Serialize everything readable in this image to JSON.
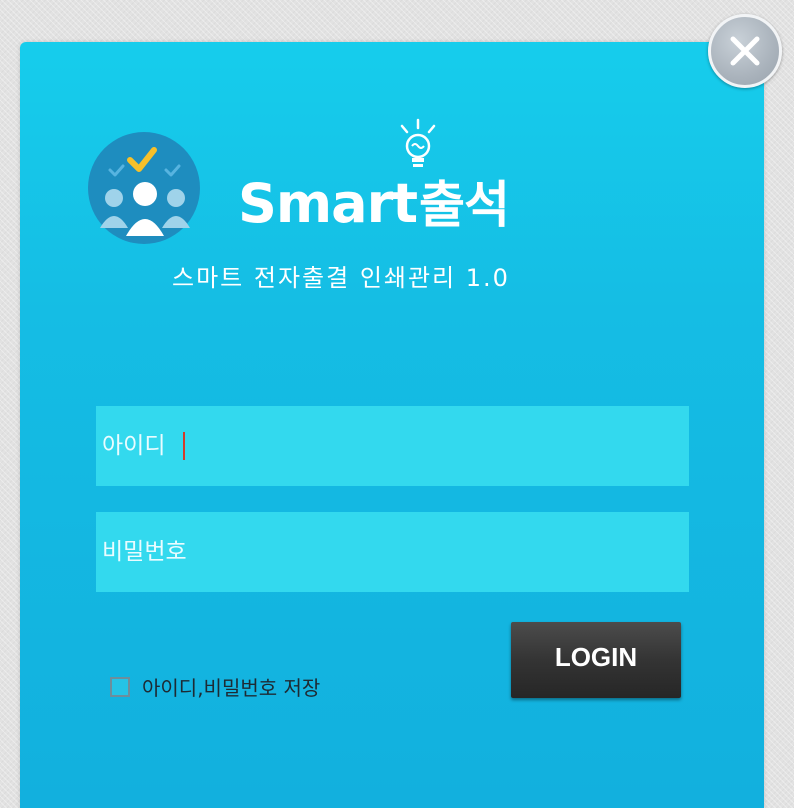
{
  "window": {
    "close_icon": "close-icon",
    "panel_color": "#16cdec",
    "close_button_color": "#aab3bc"
  },
  "brand": {
    "name_en": "Smart",
    "name_ko": "출석",
    "subtitle": "스마트 전자출결 인쇄관리 1.0",
    "logo_icon": "people-check-icon",
    "bulb_icon": "lightbulb-icon"
  },
  "login": {
    "id_placeholder": "아이디",
    "id_value": "",
    "password_placeholder": "비밀번호",
    "password_value": "",
    "field_color": "#33d9ee",
    "login_label": "LOGIN",
    "login_color": "#343434",
    "save_label": "아이디,비밀번호 저장",
    "save_checked": false
  }
}
